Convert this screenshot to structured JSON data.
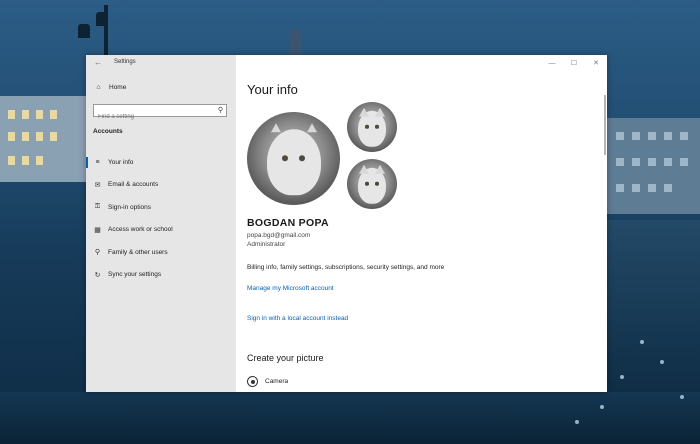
{
  "window": {
    "title": "Settings",
    "back_icon": "back-arrow-icon",
    "controls": {
      "minimize": "—",
      "maximize": "☐",
      "close": "✕"
    }
  },
  "sidebar": {
    "home_label": "Home",
    "home_icon": "home-icon",
    "search": {
      "placeholder": "Find a setting",
      "icon": "search-icon"
    },
    "section": "Accounts",
    "items": [
      {
        "label": "Your info",
        "icon": "person-card-icon",
        "active": true
      },
      {
        "label": "Email & accounts",
        "icon": "mail-icon",
        "active": false
      },
      {
        "label": "Sign-in options",
        "icon": "key-icon",
        "active": false
      },
      {
        "label": "Access work or school",
        "icon": "briefcase-icon",
        "active": false
      },
      {
        "label": "Family & other users",
        "icon": "add-person-icon",
        "active": false
      },
      {
        "label": "Sync your settings",
        "icon": "sync-icon",
        "active": false
      }
    ]
  },
  "main": {
    "heading": "Your info",
    "user": {
      "name": "BOGDAN POPA",
      "email": "popa.bgd@gmail.com",
      "role": "Administrator"
    },
    "billing_text": "Billing info, family settings, subscriptions, security settings, and more",
    "manage_link": "Manage my Microsoft account",
    "local_link": "Sign in with a local account instead",
    "create_picture_heading": "Create your picture",
    "camera_label": "Camera"
  },
  "colors": {
    "accent": "#0a5fb0",
    "sidebar_bg": "#e6e6e6",
    "content_bg": "#ffffff"
  }
}
